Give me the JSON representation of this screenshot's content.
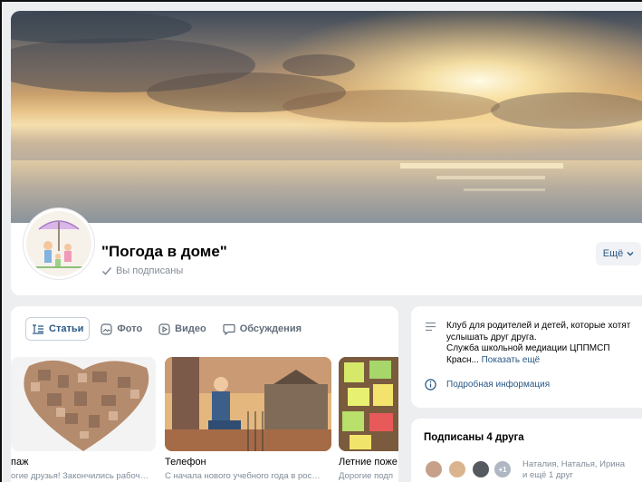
{
  "group": {
    "title": "\"Погода в доме\"",
    "subscribed_label": "Вы подписаны",
    "more_label": "Ещё"
  },
  "tabs": [
    {
      "label": "Статьи",
      "icon": "articles-icon",
      "active": true
    },
    {
      "label": "Фото",
      "icon": "photo-icon",
      "active": false
    },
    {
      "label": "Видео",
      "icon": "video-icon",
      "active": false
    },
    {
      "label": "Обсуждения",
      "icon": "discussion-icon",
      "active": false
    }
  ],
  "articles": [
    {
      "title": "паж",
      "text": "огие друзья! Закончились рабоч…"
    },
    {
      "title": "Телефон",
      "text": "С начала нового учебного года в рос…"
    },
    {
      "title": "Летние поже",
      "text": "Дорогие подп"
    }
  ],
  "info": {
    "description_line1": "Клуб для родителей и детей, которые хотят",
    "description_line2": "услышать друг друга.",
    "description_line3": "Служба школьной медиации ЦППМСП",
    "description_line4": "Красн...",
    "show_more": "Показать ещё",
    "details_link": "Подробная информация"
  },
  "friends": {
    "title": "Подписаны 4 друга",
    "extra_badge": "+1",
    "names_line1": "Наталия, Наталья, Ирина",
    "names_line2": "и ещё 1 друг"
  },
  "colors": {
    "accent": "#2a5885",
    "muted": "#818c99",
    "background": "#edeef0"
  }
}
